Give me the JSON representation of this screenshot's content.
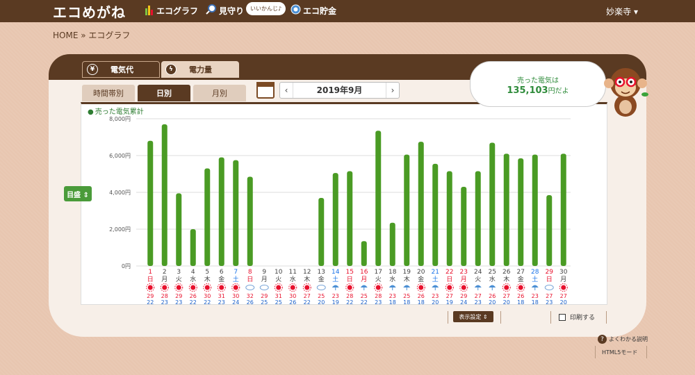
{
  "header": {
    "logo": "エコめがね",
    "nav": [
      {
        "label": "エコグラフ",
        "icon": "bar-chart-icon"
      },
      {
        "label": "見守り",
        "icon": "magnifier-icon"
      },
      {
        "label": "エコ貯金",
        "icon": "coin-icon"
      }
    ],
    "bubble": "いいかんじ♪",
    "user": "妙楽寺 ▾"
  },
  "breadcrumb": "HOME » エコグラフ",
  "main_tabs": [
    {
      "label": "電気代",
      "icon": "¥"
    },
    {
      "label": "電力量",
      "icon": "ϟ"
    }
  ],
  "sub_tabs": [
    "時間帯別",
    "日別",
    "月別"
  ],
  "date": {
    "prev": "‹",
    "label": "2019年9月",
    "next": "›"
  },
  "summary": {
    "line1": "売った電気は",
    "value": "135,103",
    "suffix": "円だよ"
  },
  "legend": "売った電気累計",
  "scale_button": "目盛 ⇕",
  "controls": {
    "settings": "表示設定 ⇕",
    "print": "印刷する",
    "help": "よくわかる説明",
    "html5": "HTML5モード"
  },
  "colors": {
    "bar": "#4a9b24",
    "brown": "#5a3a22",
    "sun": "#e8112d",
    "sat": "#1a73e8",
    "sun_day": "#e8112d"
  },
  "chart_data": {
    "type": "bar",
    "ylim": [
      0,
      8000
    ],
    "yticks": [
      "0円",
      "2,000円",
      "4,000円",
      "6,000円",
      "8,000円"
    ],
    "days": [
      "1",
      "2",
      "3",
      "4",
      "5",
      "6",
      "7",
      "8",
      "9",
      "10",
      "11",
      "12",
      "13",
      "14",
      "15",
      "16",
      "17",
      "18",
      "19",
      "20",
      "21",
      "22",
      "23",
      "24",
      "25",
      "26",
      "27",
      "28",
      "29",
      "30"
    ],
    "weekdays": [
      "日",
      "月",
      "火",
      "水",
      "木",
      "金",
      "土",
      "日",
      "月",
      "火",
      "水",
      "木",
      "金",
      "土",
      "日",
      "月",
      "火",
      "水",
      "木",
      "金",
      "土",
      "日",
      "月",
      "火",
      "水",
      "木",
      "金",
      "土",
      "日",
      "月"
    ],
    "daytype": [
      "sun",
      "",
      "",
      "",
      "",
      "",
      "sat",
      "sun",
      "",
      "",
      "",
      "",
      "",
      "sat",
      "sun",
      "hol",
      "",
      "",
      "",
      "",
      "sat",
      "sun",
      "hol",
      "",
      "",
      "",
      "",
      "sat",
      "sun",
      ""
    ],
    "values": [
      6800,
      7700,
      3950,
      2000,
      5300,
      5900,
      5750,
      4850,
      0,
      0,
      0,
      0,
      3700,
      5050,
      5150,
      1350,
      7350,
      2350,
      6050,
      6750,
      5550,
      5150,
      4300,
      5150,
      6700,
      6100,
      5850,
      6050,
      3850,
      6100
    ],
    "weather": [
      "sun",
      "sun",
      "sun-cloud",
      "sun",
      "sun",
      "sun",
      "sun-cloud",
      "cloud",
      "cloud-sun",
      "sun-cloud",
      "sun-cloud",
      "sun-cloud",
      "cloud",
      "umbrella",
      "sun-cloud",
      "umbrella",
      "sun",
      "umbrella",
      "umbrella-sun",
      "sun-umbrella",
      "umbrella",
      "sun",
      "sun-cloud",
      "umbrella",
      "umbrella",
      "sun",
      "sun-cloud",
      "umbrella",
      "cloud-sun",
      "sun"
    ],
    "high": [
      "29",
      "28",
      "29",
      "26",
      "30",
      "31",
      "30",
      "32",
      "29",
      "31",
      "30",
      "27",
      "25",
      "23",
      "28",
      "25",
      "28",
      "23",
      "25",
      "26",
      "23",
      "27",
      "29",
      "27",
      "26",
      "27",
      "26",
      "23",
      "27",
      "27"
    ],
    "low": [
      "22",
      "23",
      "23",
      "22",
      "22",
      "23",
      "24",
      "26",
      "25",
      "25",
      "26",
      "22",
      "20",
      "19",
      "22",
      "22",
      "23",
      "18",
      "18",
      "18",
      "20",
      "19",
      "24",
      "23",
      "20",
      "20",
      "18",
      "18",
      "23",
      "20"
    ]
  }
}
